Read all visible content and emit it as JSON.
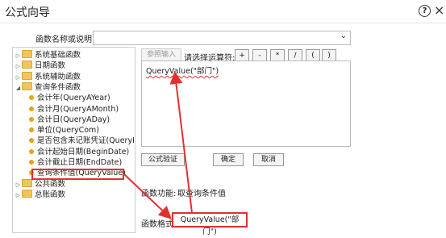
{
  "window": {
    "title": "公式向导"
  },
  "description": {
    "label": "函数名称或说明:",
    "value": ""
  },
  "tree": {
    "items": [
      {
        "label": "系统基础函数",
        "kind": "folder",
        "level": 0,
        "expanded": false
      },
      {
        "label": "日期函数",
        "kind": "folder",
        "level": 0,
        "expanded": false
      },
      {
        "label": "系统辅助函数",
        "kind": "folder",
        "level": 0,
        "expanded": false
      },
      {
        "label": "查询条件函数",
        "kind": "folder",
        "level": 0,
        "expanded": true
      },
      {
        "label": "会计年(QueryAYear)",
        "kind": "func",
        "level": 1
      },
      {
        "label": "会计月(QueryAMonth)",
        "kind": "func",
        "level": 1
      },
      {
        "label": "会计日(QueryADay)",
        "kind": "func",
        "level": 1
      },
      {
        "label": "单位(QueryCom)",
        "kind": "func",
        "level": 1
      },
      {
        "label": "是否包含未记账凭证(QueryI",
        "kind": "func",
        "level": 1
      },
      {
        "label": "会计起始日期(BeginDate)",
        "kind": "func",
        "level": 1
      },
      {
        "label": "会计截止日期(EndDate)",
        "kind": "func",
        "level": 1
      },
      {
        "label": "查询条件值(QueryValue)",
        "kind": "func",
        "level": 1,
        "selected": true
      },
      {
        "label": "公共函数",
        "kind": "folder",
        "level": 0,
        "expanded": false
      },
      {
        "label": "总账函数",
        "kind": "folder",
        "level": 0,
        "expanded": false
      }
    ]
  },
  "toolbar": {
    "ref_input": "参照输入",
    "operator_label": "请选择运算符:",
    "operators": [
      "+",
      "-",
      "*",
      "/",
      "(",
      ")"
    ]
  },
  "editor": {
    "value": "QueryValue(\"部门\")"
  },
  "buttons": {
    "verify": "公式验证",
    "ok": "确定",
    "cancel": "取消"
  },
  "info": {
    "func_label": "函数功能:",
    "func_desc": "取查询条件值",
    "format_label": "函数格式",
    "format_value": "QueryValue(\"部门\")"
  },
  "colors": {
    "highlight": "#e23030",
    "folder": "#f2c55c",
    "func_dot": "#e8a317"
  }
}
